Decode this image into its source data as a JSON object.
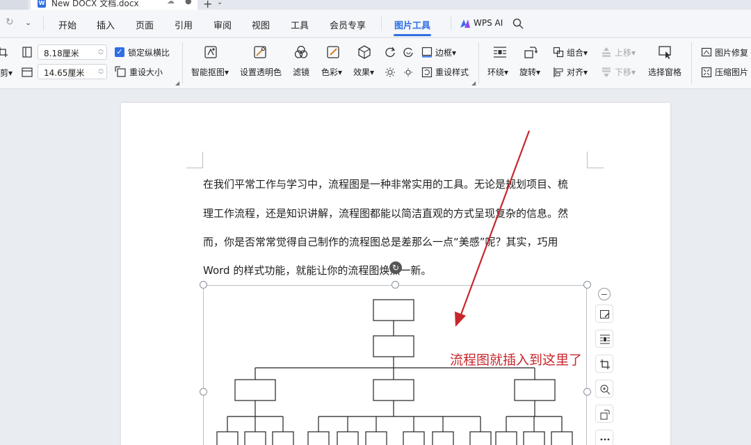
{
  "tabs": {
    "doc_title": "New DOCX 文档.docx",
    "doc_icon_letter": "W"
  },
  "menu": {
    "items": [
      "开始",
      "插入",
      "页面",
      "引用",
      "审阅",
      "视图",
      "工具",
      "会员专享",
      "图片工具"
    ],
    "active": "图片工具",
    "wps_ai": "WPS AI"
  },
  "ribbon": {
    "width_value": "8.18厘米",
    "height_value": "14.65厘米",
    "lock_ratio": "锁定纵横比",
    "resize": "重设大小",
    "crop": "剪",
    "smart_cutout": "智能抠图",
    "transparent": "设置透明色",
    "filter": "滤镜",
    "color": "色彩",
    "effect": "效果",
    "border": "边框",
    "reset_style": "重设样式",
    "wrap": "环绕",
    "rotate": "旋转",
    "group": "组合",
    "align": "对齐",
    "move_up": "上移",
    "move_down": "下移",
    "selection_pane": "选择窗格",
    "repair": "图片修复",
    "compress": "压缩图片"
  },
  "document": {
    "paragraph_lines": [
      "在我们平常工作与学习中，流程图是一种非常实用的工具。无论是规划项目、梳",
      "理工作流程，还是知识讲解，流程图都能以简洁直观的方式呈现复杂的信息。然",
      "而，你是否常常觉得自己制作的流程图总是差那么一点“美感”呢？其实，巧用",
      "Word 的样式功能，就能让你的流程图焕然一新。"
    ]
  },
  "annotation": {
    "text": "流程图就插入到这里了",
    "color": "#c8262b"
  },
  "colors": {
    "accent": "#2f6fe4"
  }
}
